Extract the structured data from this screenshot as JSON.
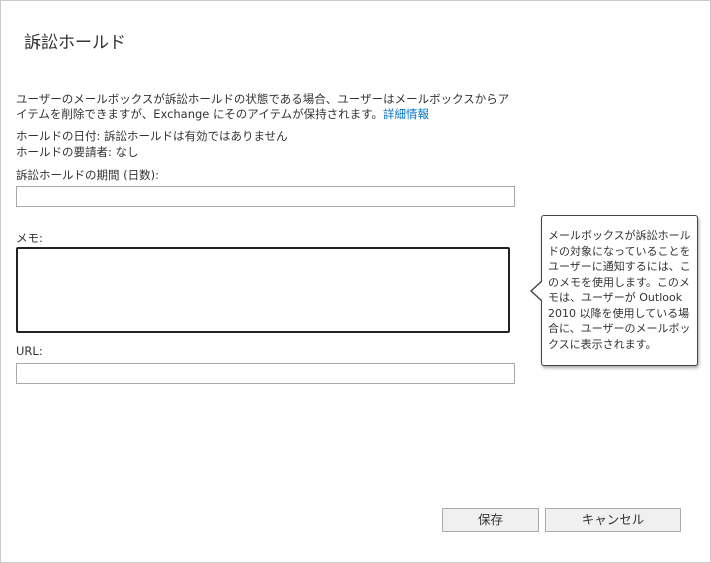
{
  "dialog": {
    "title": "訴訟ホールド",
    "description": "ユーザーのメールボックスが訴訟ホールドの状態である場合、ユーザーはメールボックスからアイテムを削除できますが、Exchange にそのアイテムが保持されます。",
    "learn_more_link": "詳細情報",
    "hold_date_line": "ホールドの日付: 訴訟ホールドは有効ではありません",
    "hold_requester_line": "ホールドの要請者: なし"
  },
  "fields": {
    "duration_label": "訴訟ホールドの期間 (日数):",
    "duration_value": "",
    "memo_label": "メモ:",
    "memo_value": "",
    "url_label": "URL:",
    "url_value": ""
  },
  "tooltip": {
    "text": "メールボックスが訴訟ホールドの対象になっていることをユーザーに通知するには、このメモを使用します。このメモは、ユーザーが Outlook 2010 以降を使用している場合に、ユーザーのメールボックスに表示されます。"
  },
  "buttons": {
    "save": "保存",
    "cancel": "キャンセル"
  }
}
